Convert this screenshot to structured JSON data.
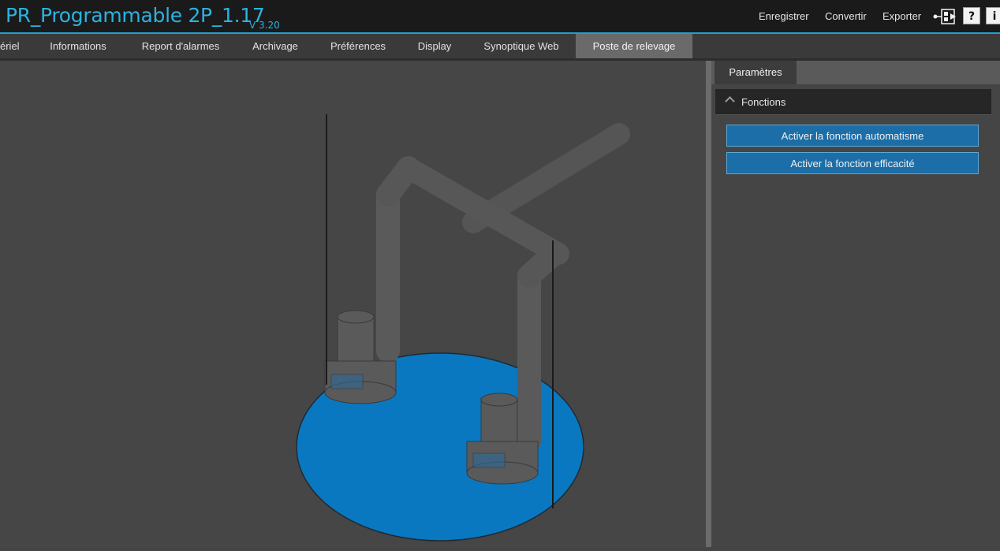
{
  "header": {
    "title": "PR_Programmable 2P_1.17",
    "version": "V 3.20",
    "actions": [
      "Enregistrer",
      "Convertir",
      "Exporter"
    ],
    "icons": [
      "network-icon",
      "help-icon",
      "info-icon"
    ],
    "help_glyph": "?",
    "info_glyph": "i"
  },
  "tabs": [
    {
      "label": "ériel"
    },
    {
      "label": "Informations"
    },
    {
      "label": "Report d'alarmes"
    },
    {
      "label": "Archivage"
    },
    {
      "label": "Préférences"
    },
    {
      "label": "Display"
    },
    {
      "label": "Synoptique Web"
    },
    {
      "label": "Poste de relevage",
      "active": true
    }
  ],
  "panel": {
    "tab": "Paramètres",
    "section": {
      "label": "Fonctions",
      "expanded": true,
      "buttons": [
        "Activer la fonction automatisme",
        "Activer la fonction efficacité"
      ]
    }
  },
  "colors": {
    "accent": "#2bb3e0",
    "basin": "#0a78c0",
    "button": "#1c6ea8"
  }
}
